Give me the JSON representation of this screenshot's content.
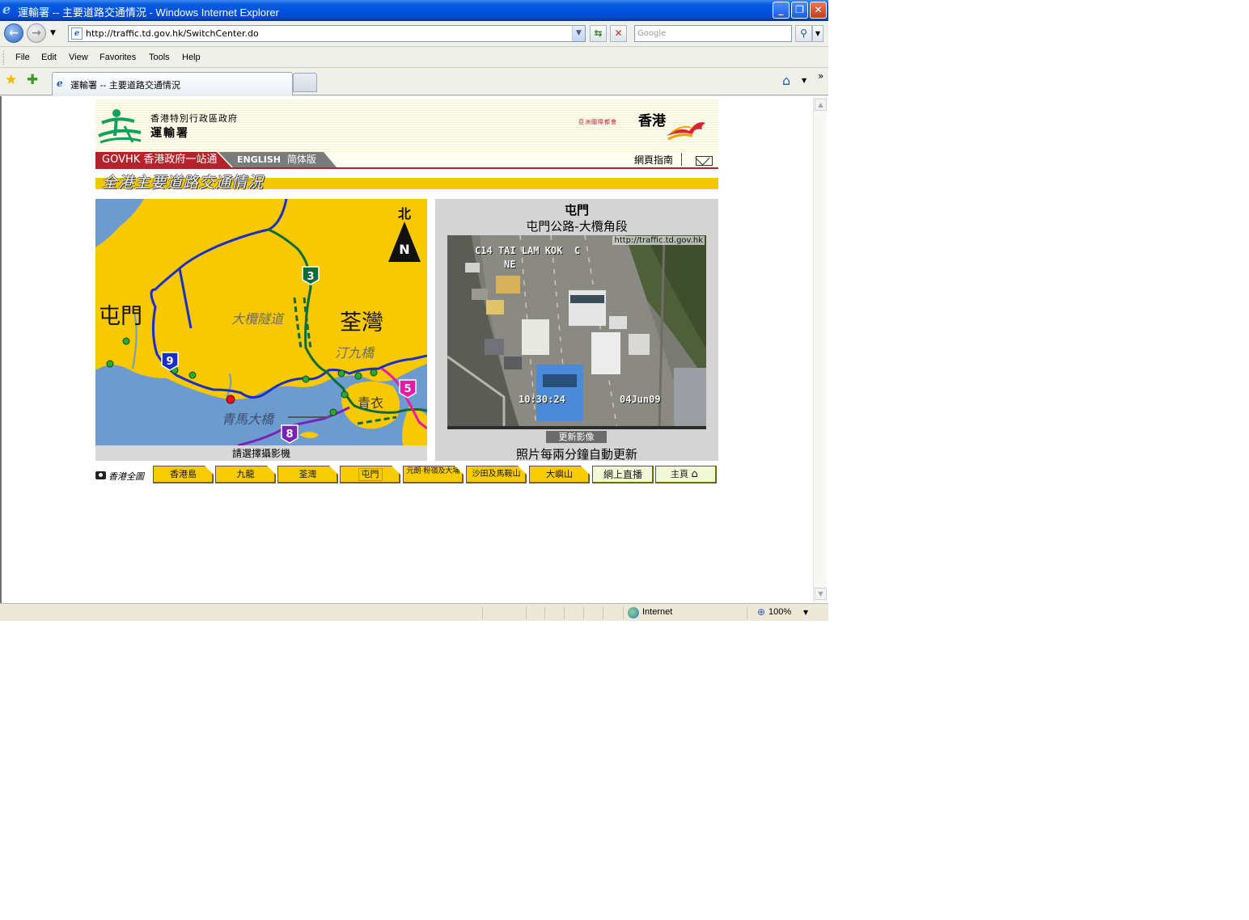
{
  "window": {
    "title": "運輸署 -- 主要道路交通情況 - Windows Internet Explorer",
    "controls": [
      "minimize",
      "restore",
      "close"
    ]
  },
  "navbar": {
    "url": "http://traffic.td.gov.hk/SwitchCenter.do",
    "search_placeholder": "Google"
  },
  "menu": [
    "File",
    "Edit",
    "View",
    "Favorites",
    "Tools",
    "Help"
  ],
  "tabs": {
    "active_label": "運輸署 -- 主要道路交通情況"
  },
  "header": {
    "org_small": "香港特別行政區政府",
    "org_big": "運輸署",
    "asia_city": "亞洲國際都會",
    "hongkong": "香港",
    "govhk": "GOVHK 香港政府一站通",
    "english": "ENGLISH",
    "simplified": "简体版",
    "site_guide": "網頁指南"
  },
  "page_title": "全港主要道路交通情況",
  "map": {
    "labels": {
      "tuen_mun": "屯門",
      "tsuen_wan": "荃灣",
      "tai_lam_tunnel": "大欖隧道",
      "ting_kau_bridge": "汀九橋",
      "tsing_yi": "青衣",
      "tsing_ma_bridge": "青馬大橋",
      "north": "北",
      "north_n": "N"
    },
    "route_numbers": [
      "3",
      "9",
      "5",
      "8"
    ],
    "caption": "請選擇攝影機"
  },
  "camera": {
    "district": "屯門",
    "road": "屯門公路-大欖角段",
    "watermark": "http://traffic.td.gov.hk",
    "cam_id": "C14 TAI LAM KOK  C",
    "direction": "NE",
    "time": "10:30:24",
    "date": "04Jun09",
    "refresh_label": "更新影像",
    "note": "照片每兩分鐘自動更新"
  },
  "district_tabs": {
    "all_map": "香港全圖",
    "items": [
      "香港島",
      "九龍",
      "荃灣",
      "屯門",
      "元朗‧粉嶺及大埔",
      "沙田及馬鞍山",
      "大嶼山",
      "網上直播",
      "主頁"
    ]
  },
  "status": {
    "zone": "Internet",
    "zoom": "100%"
  },
  "colors": {
    "map_land": "#f8c800",
    "map_sea": "#6c9bd0",
    "route_blue": "#1a2fc9",
    "route_green": "#0b6b3a",
    "govhk_red": "#b2242b",
    "tab_yellow": "#f8cc00"
  }
}
